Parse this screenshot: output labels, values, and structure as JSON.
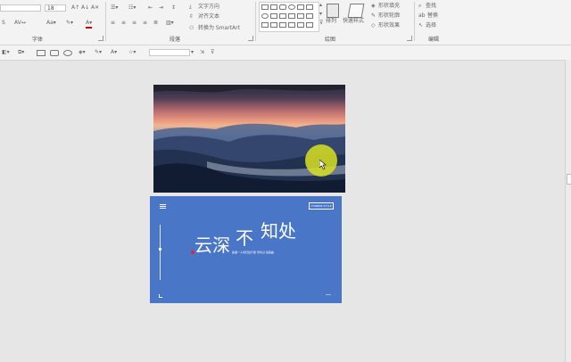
{
  "ribbon": {
    "font_size_value": "18",
    "groups": {
      "font": "字体",
      "paragraph": "段落",
      "drawing": "绘图",
      "editing": "编辑"
    },
    "paragraph": {
      "text_direction": "文字方向",
      "align_text": "对齐文本",
      "convert_smartart": "转换为 SmartArt"
    },
    "drawing": {
      "arrange": "排列",
      "quick_styles": "快速样式",
      "shape_fill": "形状填充",
      "shape_outline": "形状轮廓",
      "shape_effects": "形状效果"
    },
    "editing": {
      "find": "查找",
      "replace": "替换",
      "select": "选择"
    }
  },
  "slide2": {
    "title_part1": "云深",
    "title_part2": "不",
    "title_part3": "知处",
    "subtitle": "故事一人间归途行者   曾听过 最美曲",
    "tag": "CHINESE STYLE"
  },
  "colors": {
    "slide2_bg": "#4a76c8",
    "cursor_highlight": "#d9e021",
    "accent_red": "#e0262d"
  }
}
